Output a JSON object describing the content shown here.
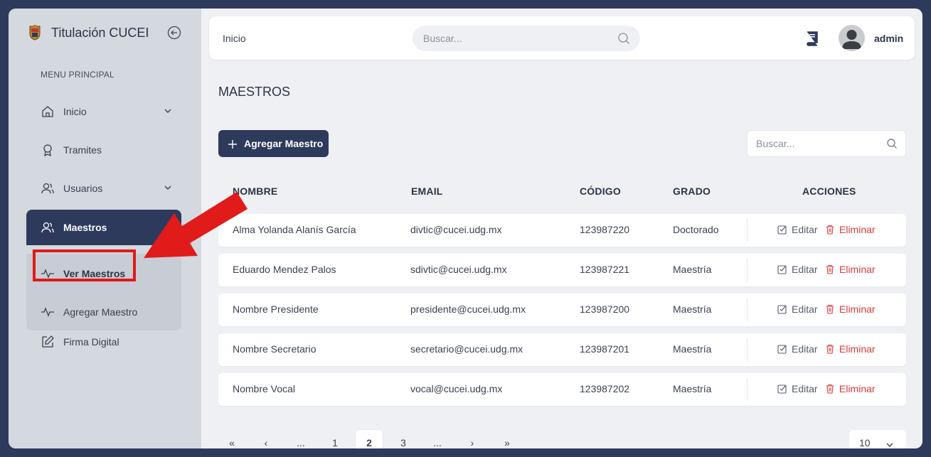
{
  "sidebar": {
    "brand": "Titulación CUCEI",
    "section_label": "MENU PRINCIPAL",
    "items": [
      {
        "label": "Inicio"
      },
      {
        "label": "Tramites"
      },
      {
        "label": "Usuarios"
      },
      {
        "label": "Maestros"
      },
      {
        "label": "Firma Digital"
      }
    ],
    "submenu": [
      {
        "label": "Ver Maestros"
      },
      {
        "label": "Agregar Maestro"
      }
    ]
  },
  "topbar": {
    "breadcrumb": "Inicio",
    "search_placeholder": "Buscar...",
    "username": "admin"
  },
  "page": {
    "title": "MAESTROS",
    "add_button": "Agregar Maestro",
    "search_placeholder": "Buscar..."
  },
  "table": {
    "columns": [
      "NOMBRE",
      "EMAIL",
      "CÓDIGO",
      "GRADO",
      "ACCIONES"
    ],
    "edit_label": "Editar",
    "delete_label": "Eliminar",
    "rows": [
      {
        "nombre": "Alma Yolanda Alanís García",
        "email": "divtic@cucei.udg.mx",
        "codigo": "123987220",
        "grado": "Doctorado"
      },
      {
        "nombre": "Eduardo Mendez Palos",
        "email": "sdivtic@cucei.udg.mx",
        "codigo": "123987221",
        "grado": "Maestría"
      },
      {
        "nombre": "Nombre Presidente",
        "email": "presidente@cucei.udg.mx",
        "codigo": "123987200",
        "grado": "Maestría"
      },
      {
        "nombre": "Nombre Secretario",
        "email": "secretario@cucei.udg.mx",
        "codigo": "123987201",
        "grado": "Maestría"
      },
      {
        "nombre": "Nombre Vocal",
        "email": "vocal@cucei.udg.mx",
        "codigo": "123987202",
        "grado": "Maestría"
      }
    ]
  },
  "pagination": {
    "first": "«",
    "prev": "‹",
    "ellipsis_left": "...",
    "pages": [
      "1",
      "2",
      "3"
    ],
    "current": "2",
    "ellipsis_right": "...",
    "next": "›",
    "last": "»",
    "per_page": "10"
  },
  "colors": {
    "primary": "#2e3a5c",
    "danger": "#d83b3b",
    "highlight": "#e11a1a"
  }
}
